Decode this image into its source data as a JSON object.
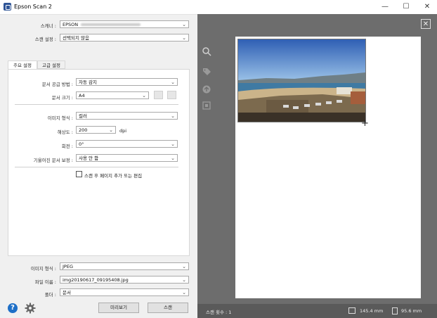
{
  "window": {
    "title": "Epson Scan 2",
    "minimize": "—",
    "maximize": "☐",
    "close": "✕"
  },
  "scanner": {
    "label": "스캐너 :",
    "value": "EPSON"
  },
  "scan_settings": {
    "label": "스캔 설정 :",
    "value": "선택되지 않음"
  },
  "tabs": [
    {
      "label": "주요 설정"
    },
    {
      "label": "고급 설정"
    }
  ],
  "main": {
    "doc_source": {
      "label": "문서 공급 방법 :",
      "value": "자동 감지"
    },
    "doc_size": {
      "label": "문서 크기 :",
      "value": "A4"
    },
    "image_type": {
      "label": "이미지 형식 :",
      "value": "컬러"
    },
    "resolution": {
      "label": "해상도 :",
      "value": "200",
      "unit": "dpi"
    },
    "rotate": {
      "label": "회전 :",
      "value": "0°"
    },
    "skew": {
      "label": "기울어진 문서 보정 :",
      "value": "사용 안 함"
    },
    "add_edit": {
      "label": "스캔 후 페이지 추가 또는 편집",
      "checked": false
    }
  },
  "output": {
    "image_format": {
      "label": "이미지 형식 :",
      "value": "JPEG"
    },
    "file_name": {
      "label": "파일 이름 :",
      "value": "img20190617_09195408.jpg"
    },
    "folder": {
      "label": "폴더 :",
      "value": "문서"
    }
  },
  "buttons": {
    "preview": "미리보기",
    "scan": "스캔"
  },
  "status": {
    "scan_count": "스캔 횟수 : 1",
    "width": "145.4 mm",
    "height": "95.6 mm"
  },
  "icons": [
    "help-icon",
    "gear-icon",
    "zoom-icon",
    "tag-icon",
    "rotate-icon",
    "crop-icon",
    "close-icon",
    "crosshair-icon"
  ],
  "colors": {
    "accent": "#2f5597",
    "preview_bg": "#6d6d6d",
    "status_bg": "#5a5a5a",
    "help_blue": "#1e6fc7"
  }
}
